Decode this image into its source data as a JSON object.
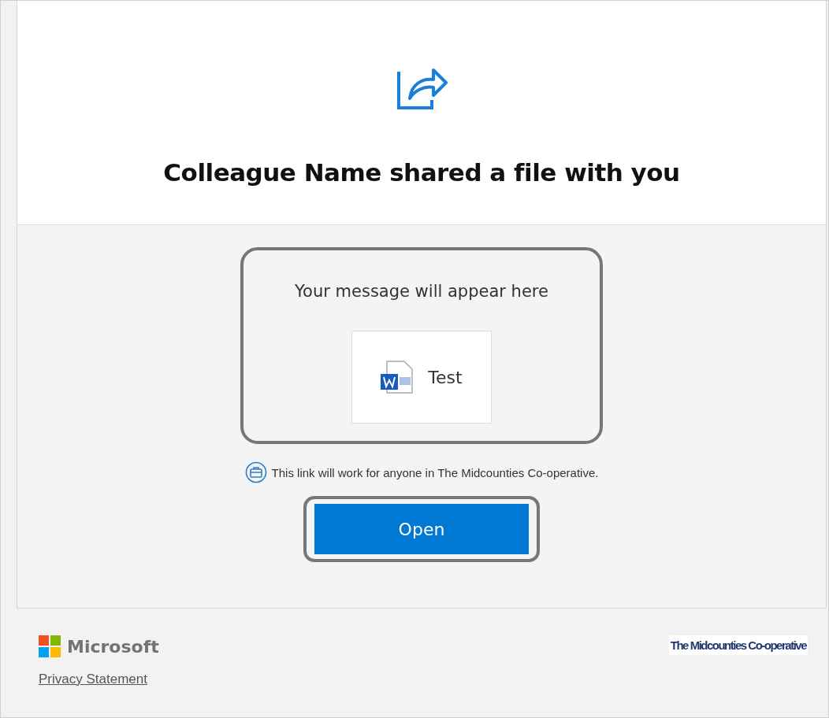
{
  "heading": "Colleague Name shared a file with you",
  "message": "Your message will appear here",
  "file": {
    "name": "Test"
  },
  "link_note": "This link will work for anyone in The Midcounties Co-operative.",
  "open_button": "Open",
  "footer": {
    "brand": "Microsoft",
    "privacy_link": "Privacy Statement",
    "org_logo": "The Midcounties Co-operative"
  }
}
